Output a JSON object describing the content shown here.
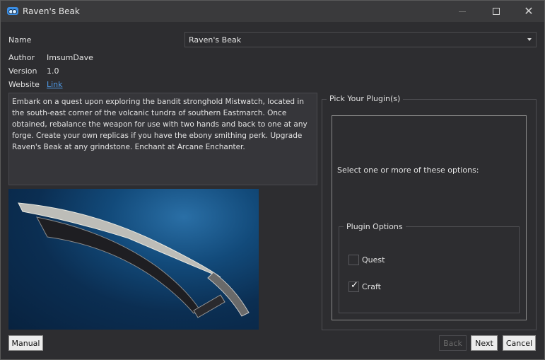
{
  "window": {
    "title": "Raven's Beak",
    "icon": "app-logo-icon"
  },
  "fields": {
    "name_label": "Name",
    "name_value": "Raven's Beak",
    "author_label": "Author",
    "author_value": "ImsumDave",
    "version_label": "Version",
    "version_value": "1.0",
    "website_label": "Website",
    "website_link": "Link"
  },
  "description": "Embark on a quest upon exploring the bandit stronghold Mistwatch, located in the south-east corner of the volcanic tundra of southern Eastmarch. Once obtained, rebalance the weapon for use with two hands and back to one at any forge. Create your own replicas if you have the ebony smithing perk. Upgrade Raven's Beak at any grindstone. Enchant at Arcane Enchanter.",
  "plugins": {
    "group_title": "Pick Your Plugin(s)",
    "instruction": "Select one or more of these options:",
    "options_title": "Plugin Options",
    "options": [
      {
        "label": "Quest",
        "checked": false
      },
      {
        "label": "Craft",
        "checked": true
      }
    ]
  },
  "buttons": {
    "manual": "Manual",
    "back": "Back",
    "next": "Next",
    "cancel": "Cancel"
  },
  "colors": {
    "background": "#2d2d30",
    "link": "#4f9be8",
    "accent": "#3a8ee6"
  }
}
